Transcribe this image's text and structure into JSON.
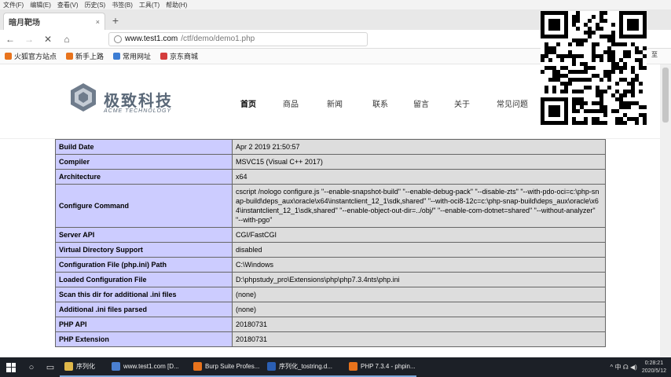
{
  "menubar": [
    "文件(F)",
    "编辑(E)",
    "查看(V)",
    "历史(S)",
    "书签(B)",
    "工具(T)",
    "帮助(H)"
  ],
  "tab": {
    "title": "暗月靶场",
    "close": "×",
    "new": "+"
  },
  "nav": {
    "back": "←",
    "forward": "→",
    "stop": "✕",
    "home": "⌂",
    "url_host": "www.test1.com",
    "url_path": "/ctf/demo/demo1.php"
  },
  "bookmarks": [
    {
      "label": "火狐官方站点",
      "color": "#e8731c"
    },
    {
      "label": "新手上路",
      "color": "#e8731c"
    },
    {
      "label": "常用网址",
      "color": "#3c7dd4"
    },
    {
      "label": "京东商城",
      "color": "#d43c3c"
    }
  ],
  "site": {
    "logo_cn": "极致科技",
    "logo_en": "ACME TECHNOLOGY",
    "nav": [
      "首页",
      "商品",
      "新闻",
      "联系",
      "留言",
      "关于",
      "常见问题"
    ]
  },
  "qr_side_text": "至",
  "phpinfo": [
    {
      "k": "Build Date",
      "v": "Apr 2 2019 21:50:57"
    },
    {
      "k": "Compiler",
      "v": "MSVC15 (Visual C++ 2017)"
    },
    {
      "k": "Architecture",
      "v": "x64"
    },
    {
      "k": "Configure Command",
      "v": "cscript /nologo configure.js \"--enable-snapshot-build\" \"--enable-debug-pack\" \"--disable-zts\" \"--with-pdo-oci=c:\\php-snap-build\\deps_aux\\oracle\\x64\\instantclient_12_1\\sdk,shared\" \"--with-oci8-12c=c:\\php-snap-build\\deps_aux\\oracle\\x64\\instantclient_12_1\\sdk,shared\" \"--enable-object-out-dir=../obj/\" \"--enable-com-dotnet=shared\" \"--without-analyzer\" \"--with-pgo\""
    },
    {
      "k": "Server API",
      "v": "CGI/FastCGI"
    },
    {
      "k": "Virtual Directory Support",
      "v": "disabled"
    },
    {
      "k": "Configuration File (php.ini) Path",
      "v": "C:\\Windows"
    },
    {
      "k": "Loaded Configuration File",
      "v": "D:\\phpstudy_pro\\Extensions\\php\\php7.3.4nts\\php.ini"
    },
    {
      "k": "Scan this dir for additional .ini files",
      "v": "(none)"
    },
    {
      "k": "Additional .ini files parsed",
      "v": "(none)"
    },
    {
      "k": "PHP API",
      "v": "20180731"
    },
    {
      "k": "PHP Extension",
      "v": "20180731"
    }
  ],
  "taskbar": {
    "apps": [
      {
        "label": "序列化",
        "color": "#e0b84a"
      },
      {
        "label": "www.test1.com [D...",
        "color": "#4a7fd0"
      },
      {
        "label": "Burp Suite Profes...",
        "color": "#e8731c"
      },
      {
        "label": "序列化_tostring.d...",
        "color": "#2b5fb3"
      },
      {
        "label": "PHP 7.3.4 - phpin...",
        "color": "#e8731c"
      }
    ],
    "tray": "^ 中 ☊ ◀)",
    "time": "0:28:21",
    "date": "2020/5/12"
  }
}
